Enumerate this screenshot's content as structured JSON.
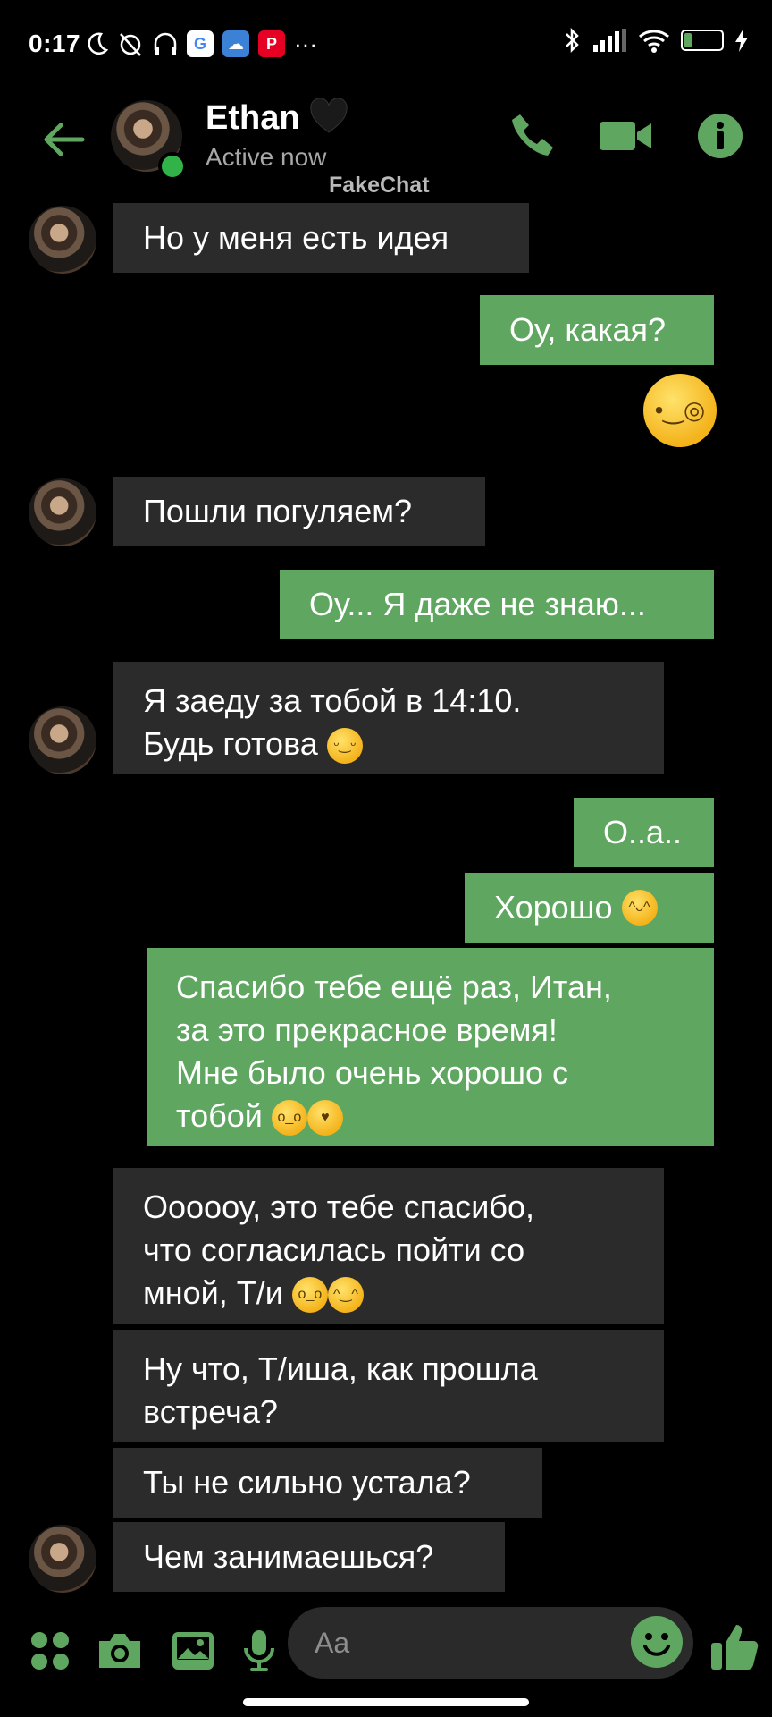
{
  "status_bar": {
    "time": "0:17",
    "battery": "19",
    "more_indicator": "···"
  },
  "header": {
    "name": "Ethan",
    "status": "Active now",
    "watermark": "FakeChat"
  },
  "messages": [
    {
      "dir": "in",
      "text": "Но у меня есть идея"
    },
    {
      "dir": "out",
      "text": "Оу, какая?"
    },
    {
      "dir": "out",
      "emoji": "monocle-face-emoji"
    },
    {
      "dir": "in",
      "text": "Пошли погуляем?"
    },
    {
      "dir": "out",
      "text": "Оу... Я даже не знаю..."
    },
    {
      "dir": "in",
      "lines": [
        "Я заеду за тобой в 14:10.",
        "Будь готова"
      ],
      "emoji": "relieved-face-emoji"
    },
    {
      "dir": "out",
      "text": "О..а.."
    },
    {
      "dir": "out",
      "text": "Хорошо",
      "emoji": "yum-face-emoji"
    },
    {
      "dir": "out",
      "lines": [
        "Спасибо тебе ещё раз, Итан,",
        "за это прекрасное время!",
        "Мне было очень хорошо с",
        "тобой"
      ],
      "emoji": "pleading-face-and-smiling-hearts-emoji"
    },
    {
      "dir": "in",
      "lines": [
        "Оооооу, это тебе спасибо,",
        "что согласилась пойти со",
        "мной, Т/и"
      ],
      "emoji": "pleading-face-and-hugging-face-emoji"
    },
    {
      "dir": "in",
      "lines": [
        "Ну что, Т/иша, как прошла",
        "встреча?"
      ]
    },
    {
      "dir": "in",
      "text": "Ты не сильно устала?"
    },
    {
      "dir": "in",
      "text": "Чем занимаешься?"
    }
  ],
  "composer": {
    "placeholder": "Aa"
  },
  "colors": {
    "accent": "#5fa760",
    "incoming_bubble": "#2b2b2b",
    "background": "#000000",
    "online": "#32b349"
  }
}
